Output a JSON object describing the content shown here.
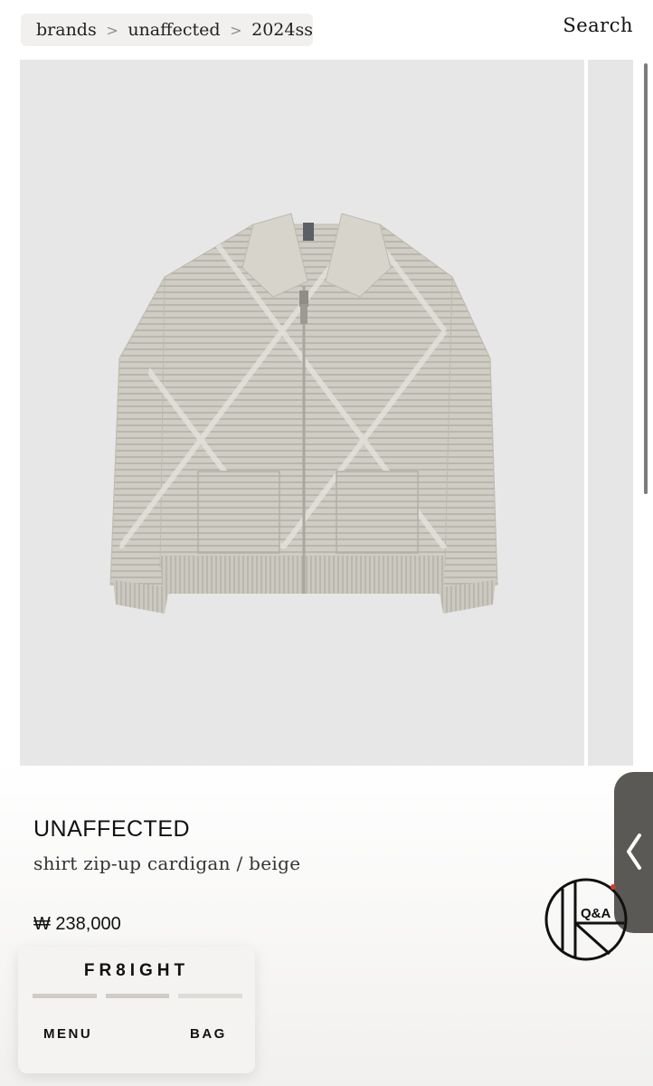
{
  "breadcrumb": {
    "items": [
      "brands",
      "unaffected",
      "2024ss"
    ]
  },
  "header": {
    "search_label": "Search"
  },
  "gallery": {
    "slide_count": 8,
    "active_index": 0
  },
  "product": {
    "brand": "UNAFFECTED",
    "name": "shirt zip-up cardigan / beige",
    "price": "₩ 238,000"
  },
  "qa_badge": {
    "label": "Q&A"
  },
  "nav": {
    "logo": "FR8IGHT",
    "menu_label": "MENU",
    "bag_label": "BAG"
  },
  "colors": {
    "gallery_bg": "#e7e7e7",
    "cardigan": "#cfcdc4",
    "accent_red": "#d33b2c"
  }
}
